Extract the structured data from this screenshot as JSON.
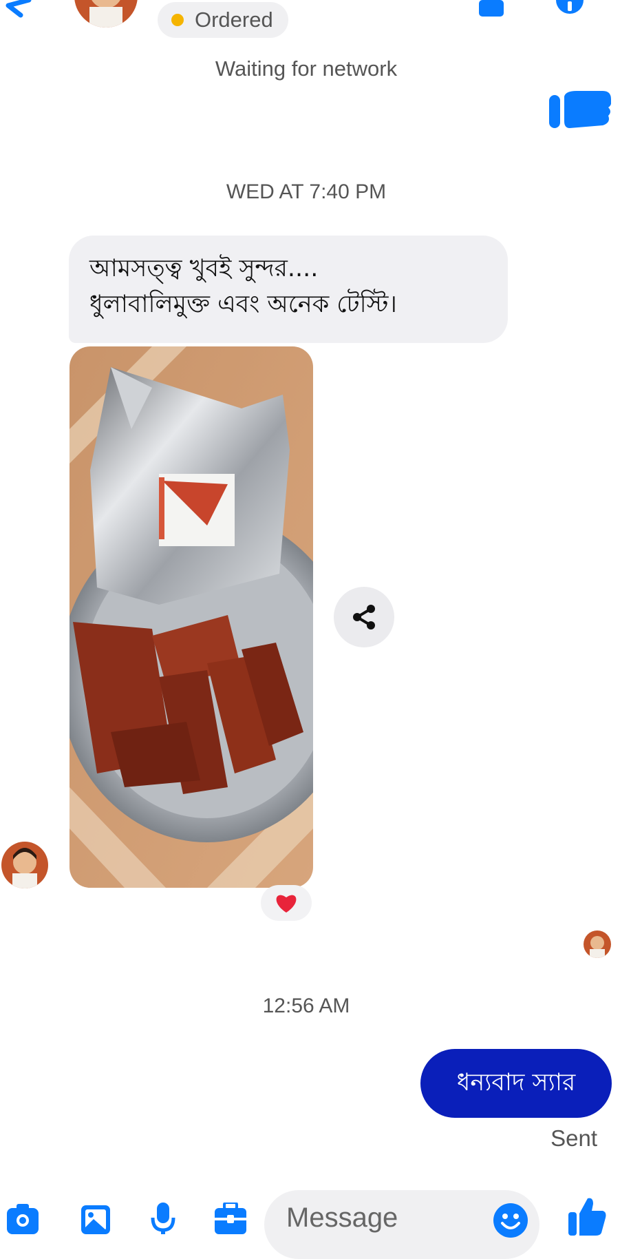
{
  "header": {
    "back_icon": "arrow-left-icon",
    "status_label": "Ordered",
    "status_color": "#f5b400",
    "call_icon": "phone-icon",
    "info_icon": "info-icon"
  },
  "network_status": "Waiting for network",
  "thread": {
    "timestamp_1": "WED AT 7:40 PM",
    "received_message": {
      "lines": [
        "আমসত্ত্ব খুবই সুন্দর....",
        "ধুলাবালিমুক্ত এবং অনেক টেস্টি।"
      ]
    },
    "reaction": "❤️",
    "timestamp_2": "12:56 AM",
    "sent_message": "ধন্যবাদ স্যার",
    "sent_status": "Sent"
  },
  "composer": {
    "placeholder": "Message",
    "icons": [
      "camera-icon",
      "image-icon",
      "microphone-icon",
      "toolbox-icon",
      "emoji-icon",
      "thumbs-up-icon"
    ]
  },
  "colors": {
    "accent": "#0a7cff",
    "sent_bubble": "#0a1fba",
    "received_bubble": "#f0f0f3"
  }
}
